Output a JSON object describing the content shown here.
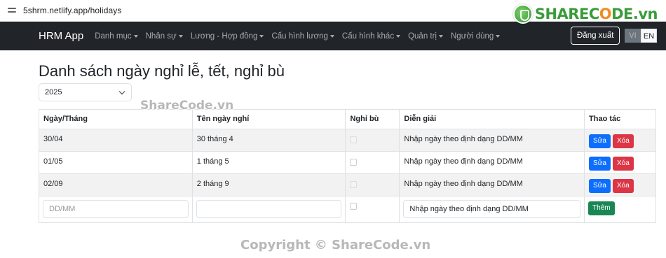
{
  "browser": {
    "url": "5shrm.netlify.app/holidays"
  },
  "logo": {
    "part1": "SHARE",
    "part2": "C",
    "part3": "O",
    "part4": "DE.vn"
  },
  "navbar": {
    "brand": "HRM App",
    "items": [
      {
        "label": "Danh mục"
      },
      {
        "label": "Nhân sự"
      },
      {
        "label": "Lương - Hợp đồng"
      },
      {
        "label": "Cấu hình lương"
      },
      {
        "label": "Cấu hình khác"
      },
      {
        "label": "Quản trị"
      },
      {
        "label": "Người dùng"
      }
    ],
    "logout_label": "Đăng xuất",
    "lang_vi": "VI",
    "lang_en": "EN"
  },
  "page": {
    "title": "Danh sách ngày nghỉ lễ, tết, nghỉ bù",
    "year": "2025"
  },
  "table": {
    "headers": [
      "Ngày/Tháng",
      "Tên ngày nghỉ",
      "Nghỉ bù",
      "Diễn giải",
      "Thao tác"
    ],
    "rows": [
      {
        "date": "30/04",
        "name": "30 tháng 4",
        "desc": "Nhập ngày theo định dạng DD/MM"
      },
      {
        "date": "01/05",
        "name": "1 tháng 5",
        "desc": "Nhập ngày theo định dạng DD/MM"
      },
      {
        "date": "02/09",
        "name": "2 tháng 9",
        "desc": "Nhập ngày theo định dạng DD/MM"
      }
    ],
    "edit_label": "Sửa",
    "delete_label": "Xóa",
    "new_row": {
      "date_placeholder": "DD/MM",
      "name_value": "",
      "desc_value": "Nhập ngày theo định dạng DD/MM",
      "add_label": "Thêm"
    }
  },
  "watermarks": {
    "top": "ShareCode.vn",
    "bottom": "Copyright © ShareCode.vn"
  }
}
